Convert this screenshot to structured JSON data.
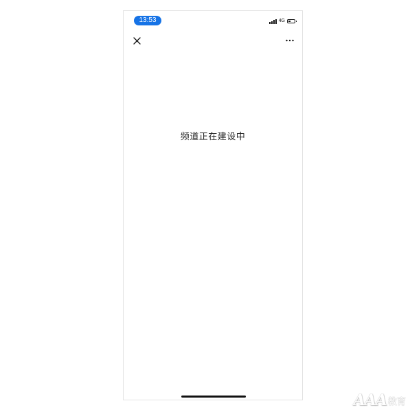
{
  "status_bar": {
    "time": "13:53",
    "network": "4G",
    "battery_level": 0.4,
    "time_pill_color": "#1673e6"
  },
  "nav": {
    "close_icon": "close-icon",
    "more_icon": "more-horizontal-icon"
  },
  "main": {
    "message": "频道正在建设中"
  },
  "watermark": {
    "main": "AAA",
    "sub": "教育"
  }
}
